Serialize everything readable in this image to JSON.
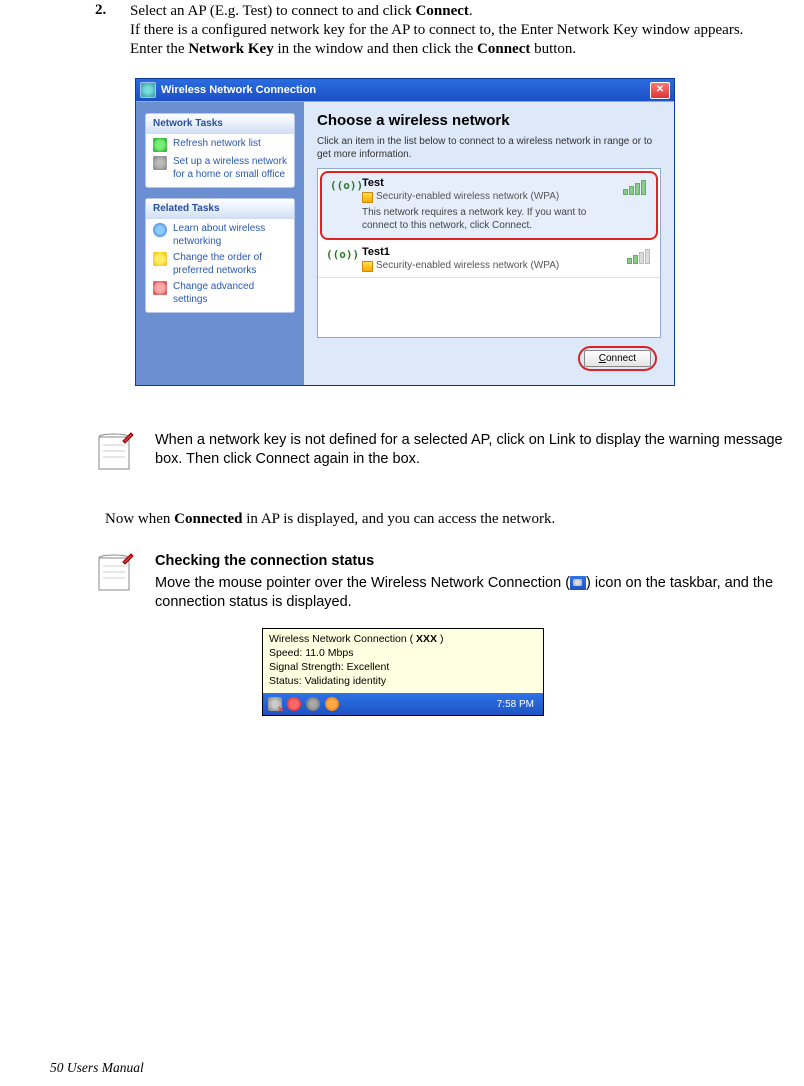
{
  "step": {
    "num": "2.",
    "line1a": "Select an AP (E.g. Test) to connect to and click ",
    "line1b": "Connect",
    "line1c": ".",
    "line2": "If there is a configured network key for the AP to connect to, the Enter Network Key window appears.",
    "line3a": "Enter the ",
    "line3b": "Network Key",
    "line3c": " in the window and then click the ",
    "line3d": "Connect",
    "line3e": " button."
  },
  "dialog": {
    "title": "Wireless Network Connection",
    "left": {
      "box1_title": "Network Tasks",
      "box1_items": [
        "Refresh network list",
        "Set up a wireless network for a home or small office"
      ],
      "box2_title": "Related Tasks",
      "box2_items": [
        "Learn about wireless networking",
        "Change the order of preferred networks",
        "Change advanced settings"
      ]
    },
    "right": {
      "heading": "Choose a wireless network",
      "sub": "Click an item in the list below to connect to a wireless network in range or to get more information.",
      "net1": {
        "name": "Test",
        "sec": "Security-enabled wireless network (WPA)",
        "desc": "This network requires a network key. If you want to connect to this network, click Connect."
      },
      "net2": {
        "name": "Test1",
        "sec": "Security-enabled wireless network (WPA)"
      },
      "connect_u": "C",
      "connect_rest": "onnect"
    }
  },
  "note1": "When a network key is not defined for a selected AP, click on Link to display the warning message box. Then click Connect again in the box.",
  "midline_a": "Now when ",
  "midline_b": "Connected",
  "midline_c": " in AP is displayed, and you can access the network.",
  "note2_heading": "Checking the connection status",
  "note2_body_a": "Move the mouse pointer over the Wireless Network Connection (",
  "note2_body_b": ") icon on the taskbar, and the connection status is displayed.",
  "tooltip": {
    "l1a": "Wireless Network Connection ( ",
    "l1b": "XXX",
    "l1c": "  )",
    "l2": "Speed: 11.0 Mbps",
    "l3": "Signal Strength: Excellent",
    "l4": "Status: Validating identity",
    "time": "7:58 PM"
  },
  "footer": "50  Users Manual"
}
